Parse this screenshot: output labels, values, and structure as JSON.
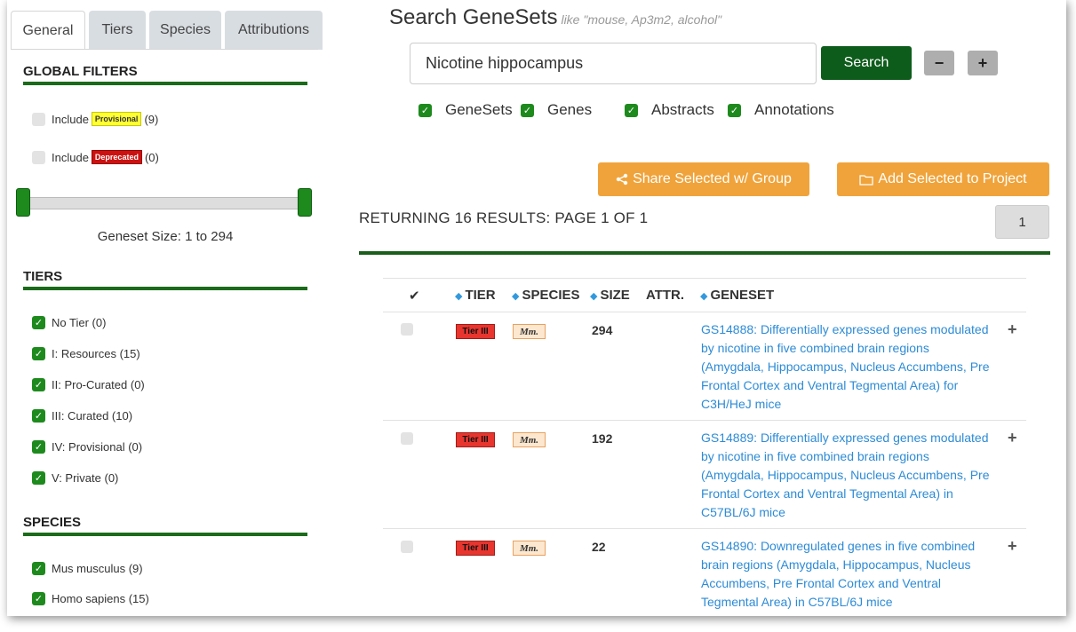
{
  "sidebar": {
    "tabs": [
      "General",
      "Tiers",
      "Species",
      "Attributions"
    ],
    "global_filters": {
      "heading": "GLOBAL FILTERS",
      "include_label": "Include",
      "provisional": {
        "badge": "Provisional",
        "count": "(9)"
      },
      "deprecated": {
        "badge": "Deprecated",
        "count": "(0)"
      }
    },
    "geneset_size_label": "Geneset Size: 1 to 294",
    "tiers": {
      "heading": "TIERS",
      "items": [
        "No Tier (0)",
        "I: Resources (15)",
        "II: Pro-Curated (0)",
        "III: Curated (10)",
        "IV: Provisional (0)",
        "V: Private (0)"
      ]
    },
    "species": {
      "heading": "SPECIES",
      "items": [
        "Mus musculus (9)",
        "Homo sapiens (15)"
      ]
    }
  },
  "search": {
    "title": "Search GeneSets",
    "hint": "like \"mouse, Ap3m2, alcohol\"",
    "value": "Nicotine hippocampus",
    "button": "Search",
    "minus": "−",
    "plus": "+",
    "options": [
      "GeneSets",
      "Genes",
      "Abstracts",
      "Annotations"
    ]
  },
  "actions": {
    "share": "Share Selected w/ Group",
    "add": "Add Selected to Project"
  },
  "results": {
    "summary": "RETURNING 16 RESULTS: PAGE 1 OF 1",
    "page": "1",
    "columns": [
      "TIER",
      "SPECIES",
      "SIZE",
      "ATTR.",
      "GENESET"
    ],
    "check_header": "✔",
    "rows": [
      {
        "tier": "Tier III",
        "species": "Mm.",
        "size": "294",
        "geneset": "GS14888: Differentially expressed genes modulated by nicotine in five combined brain regions (Amygdala, Hippocampus, Nucleus Accumbens, Pre Frontal Cortex and Ventral Tegmental Area) for C3H/HeJ mice"
      },
      {
        "tier": "Tier III",
        "species": "Mm.",
        "size": "192",
        "geneset": "GS14889: Differentially expressed genes modulated by nicotine in five combined brain regions (Amygdala, Hippocampus, Nucleus Accumbens, Pre Frontal Cortex and Ventral Tegmental Area) in C57BL/6J mice"
      },
      {
        "tier": "Tier III",
        "species": "Mm.",
        "size": "22",
        "geneset": "GS14890: Downregulated genes in five combined brain regions (Amygdala, Hippocampus, Nucleus Accumbens, Pre Frontal Cortex and Ventral Tegmental Area) in C57BL/6J mice"
      }
    ]
  },
  "colors": {
    "accent_green": "#1b6b1b",
    "search_button": "#0e5c1c",
    "orange": "#f0a33a",
    "link": "#2d8bd6",
    "tier_badge": "#e8352e"
  }
}
